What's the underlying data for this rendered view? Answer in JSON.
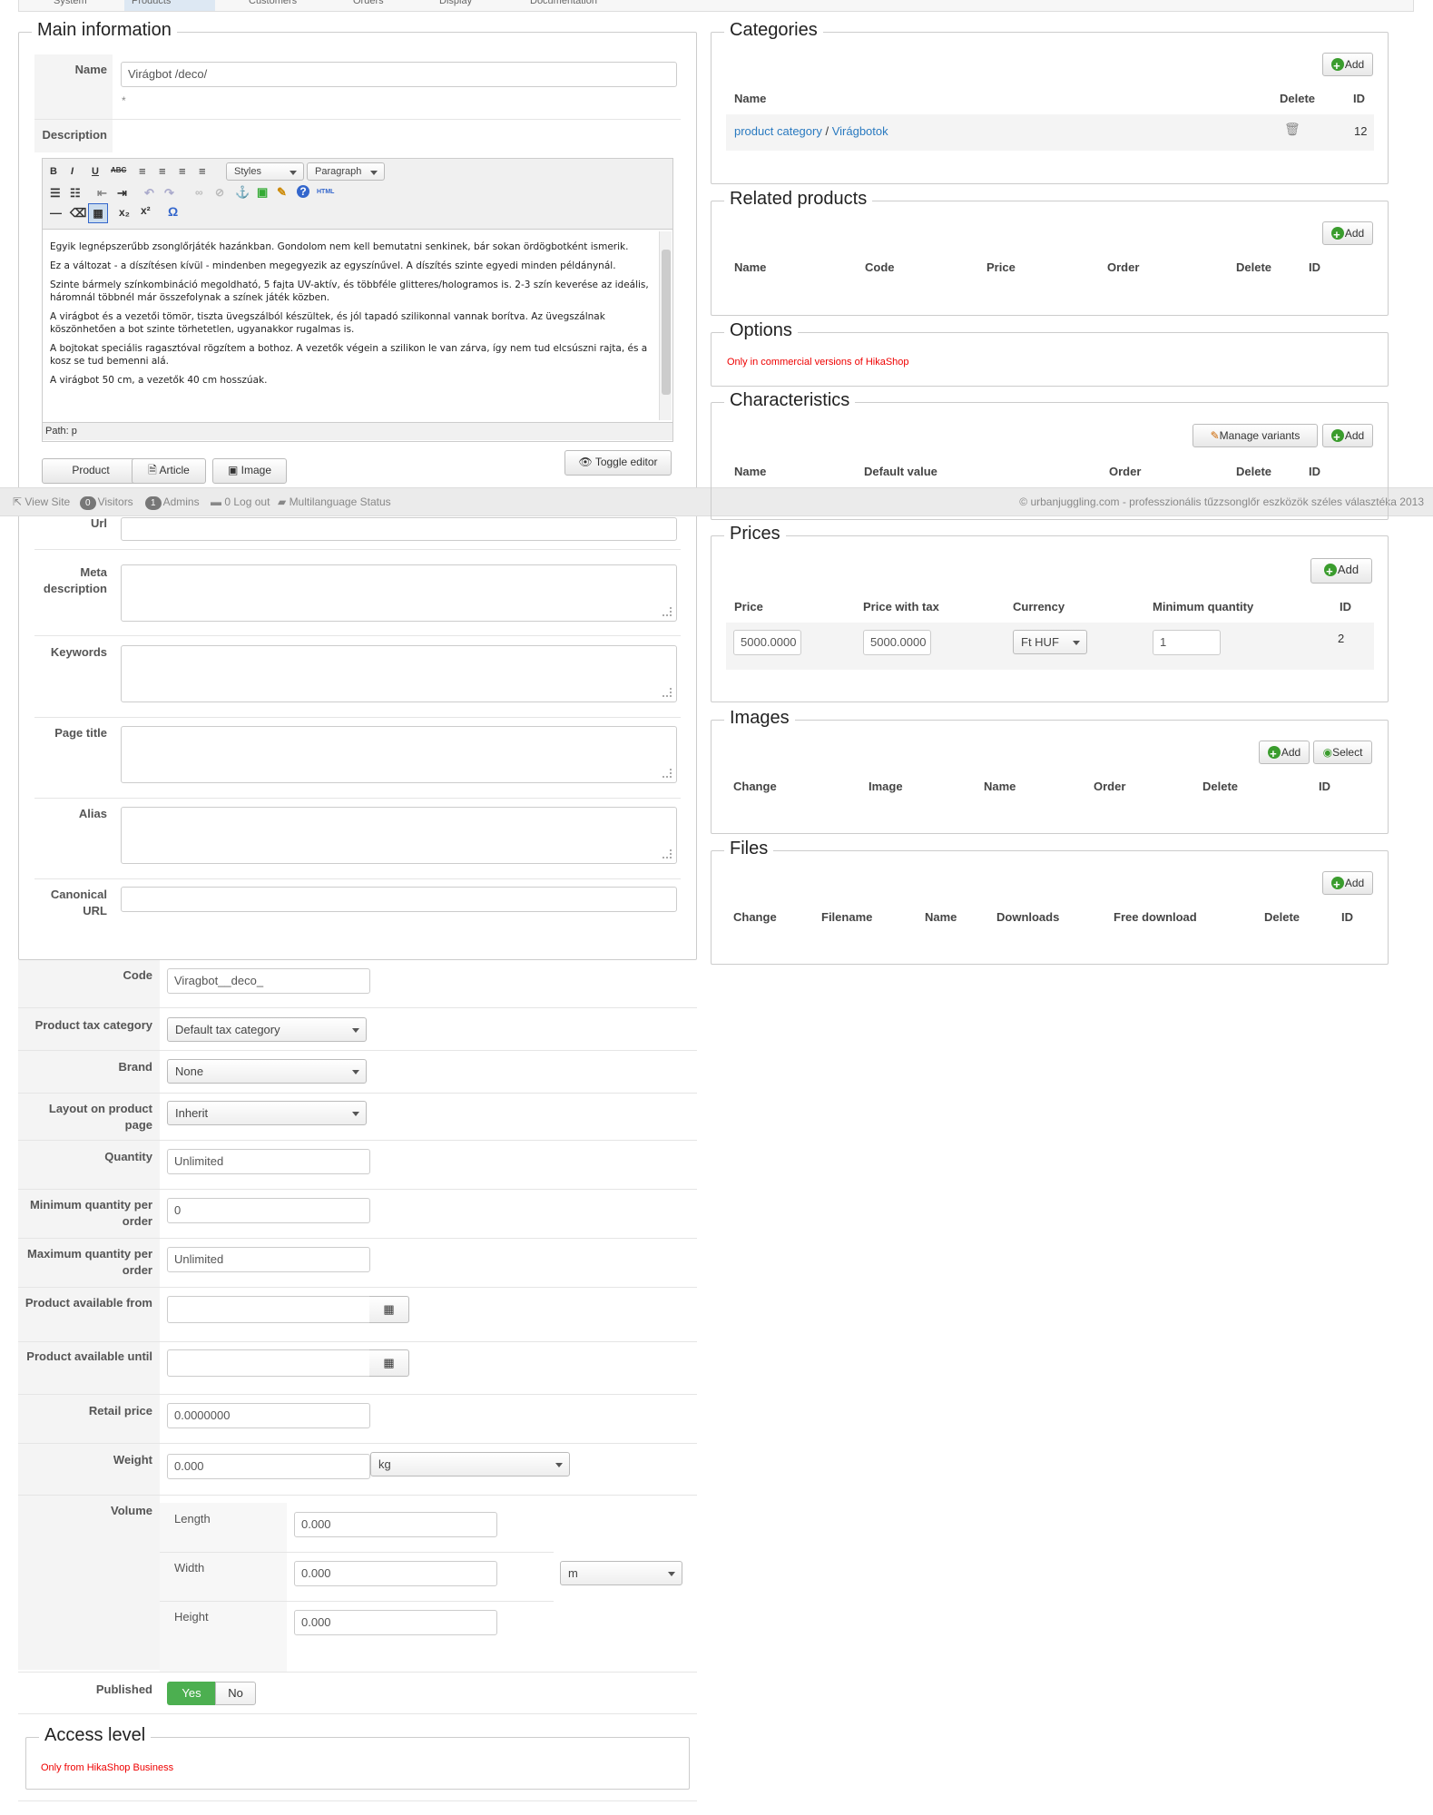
{
  "topnav": {
    "tabs": [
      "System",
      "Products",
      "Customers",
      "Orders",
      "Display",
      "Documentation"
    ]
  },
  "main_info": {
    "legend": "Main information",
    "name_label": "Name",
    "name_value": "Virágbot /deco/",
    "required_mark": "*",
    "description_label": "Description",
    "editor": {
      "styles": "Styles",
      "paragraph": "Paragraph",
      "paragraphs": [
        "Egyik legnépszerűbb zsonglőrjáték hazánkban. Gondolom nem kell bemutatni senkinek, bár sokan ördögbotként ismerik.",
        "Ez a változat - a díszítésen kívül - mindenben megegyezik az egyszínűvel. A díszítés szinte egyedi minden példánynál.",
        "Szinte bármely színkombináció megoldható, 5 fajta UV-aktív, és többféle glitteres/hologramos is. 2-3 szín keverése az ideális, háromnál többnél már összefolynak a színek játék közben.",
        "A virágbot és a vezetői tömör, tiszta üvegszálból készültek, és jól tapadó szilikonnal vannak borítva. Az üvegszálnak köszönhetően a bot szinte törhetetlen, ugyanakkor rugalmas is.",
        "A bojtokat speciális ragasztóval rögzítem a bothoz. A vezetők végein a szilikon le van zárva, így nem tud elcsúszni rajta, és a kosz se tud bemenni alá.",
        "A virágbot 50 cm, a vezetők 40 cm hosszúak."
      ],
      "path": "Path: p"
    },
    "buttons": {
      "product": "Product",
      "article": "Article",
      "image": "Image",
      "toggle": "Toggle editor"
    },
    "url_label": "Url",
    "meta_label": "Meta description",
    "keywords_label": "Keywords",
    "page_title_label": "Page title",
    "alias_label": "Alias",
    "canonical_label": "Canonical URL"
  },
  "status_bar": {
    "view_site": "View Site",
    "visitors_count": "0",
    "visitors": "Visitors",
    "admins_count": "1",
    "admins": "Admins",
    "logout_count": "0",
    "logout": "Log out",
    "multilang": "Multilanguage Status",
    "copyright": "© urbanjuggling.com - professzionális tűzzsonglőr eszközök széles választéka 2013"
  },
  "details": {
    "code_label": "Code",
    "code_value": "Viragbot__deco_",
    "tax_label": "Product tax category",
    "tax_value": "Default tax category",
    "brand_label": "Brand",
    "brand_value": "None",
    "layout_label": "Layout on product page",
    "layout_value": "Inherit",
    "quantity_label": "Quantity",
    "quantity_value": "Unlimited",
    "minq_label": "Minimum quantity per order",
    "minq_value": "0",
    "maxq_label": "Maximum quantity per order",
    "maxq_value": "Unlimited",
    "from_label": "Product available from",
    "until_label": "Product available until",
    "retail_label": "Retail price",
    "retail_value": "0.0000000",
    "weight_label": "Weight",
    "weight_value": "0.000",
    "weight_unit": "kg",
    "volume_label": "Volume",
    "length_label": "Length",
    "length_value": "0.000",
    "width_label": "Width",
    "width_value": "0.000",
    "dim_unit": "m",
    "height_label": "Height",
    "height_value": "0.000",
    "published_label": "Published",
    "yes": "Yes",
    "no": "No"
  },
  "access": {
    "legend": "Access level",
    "note": "Only from HikaShop Business"
  },
  "categories": {
    "legend": "Categories",
    "add": "Add",
    "col_name": "Name",
    "col_delete": "Delete",
    "col_id": "ID",
    "path_parent": "product category",
    "sep": "/",
    "path_child": "Virágbotok",
    "id": "12"
  },
  "related": {
    "legend": "Related products",
    "add": "Add",
    "cols": [
      "Name",
      "Code",
      "Price",
      "Order",
      "Delete",
      "ID"
    ]
  },
  "options": {
    "legend": "Options",
    "note": "Only in commercial versions of HikaShop"
  },
  "characteristics": {
    "legend": "Characteristics",
    "manage": "Manage variants",
    "add": "Add",
    "cols": [
      "Name",
      "Default value",
      "Order",
      "Delete",
      "ID"
    ]
  },
  "prices": {
    "legend": "Prices",
    "add": "Add",
    "cols": [
      "Price",
      "Price with tax",
      "Currency",
      "Minimum quantity",
      "ID"
    ],
    "price": "5000.0000",
    "price_tax": "5000.0000",
    "currency": "Ft HUF",
    "min_qty": "1",
    "id": "2"
  },
  "images": {
    "legend": "Images",
    "add": "Add",
    "select": "Select",
    "cols": [
      "Change",
      "Image",
      "Name",
      "Order",
      "Delete",
      "ID"
    ]
  },
  "files": {
    "legend": "Files",
    "add": "Add",
    "cols": [
      "Change",
      "Filename",
      "Name",
      "Downloads",
      "Free download",
      "Delete",
      "ID"
    ]
  },
  "colors": {
    "link": "#2a7ac0",
    "published_yes": "#4caf50",
    "note_red": "#e00000"
  }
}
